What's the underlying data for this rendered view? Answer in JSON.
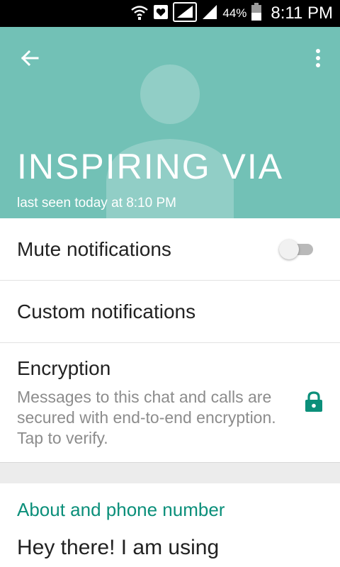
{
  "status_bar": {
    "icons": [
      "wifi-icon",
      "notification-icon",
      "signal-icon",
      "signal-icon",
      "battery-icon"
    ],
    "battery_percent": "44%",
    "time": "8:11 PM"
  },
  "header": {
    "background_color": "#72c1b6",
    "back_icon": "arrow-left-icon",
    "menu_icon": "more-vert-icon",
    "contact_name": "INSPIRING  VIA",
    "last_seen": "last seen today at 8:10 PM"
  },
  "settings": {
    "mute": {
      "label": "Mute notifications",
      "enabled": false
    },
    "custom": {
      "label": "Custom notifications"
    },
    "encryption": {
      "label": "Encryption",
      "description": "Messages to this chat and calls are secured with end-to-end encryption. Tap to verify.",
      "icon": "lock-icon"
    }
  },
  "about": {
    "title": "About and phone number",
    "status_text": "Hey there! I am using",
    "accent_color": "#0b8f7a"
  }
}
